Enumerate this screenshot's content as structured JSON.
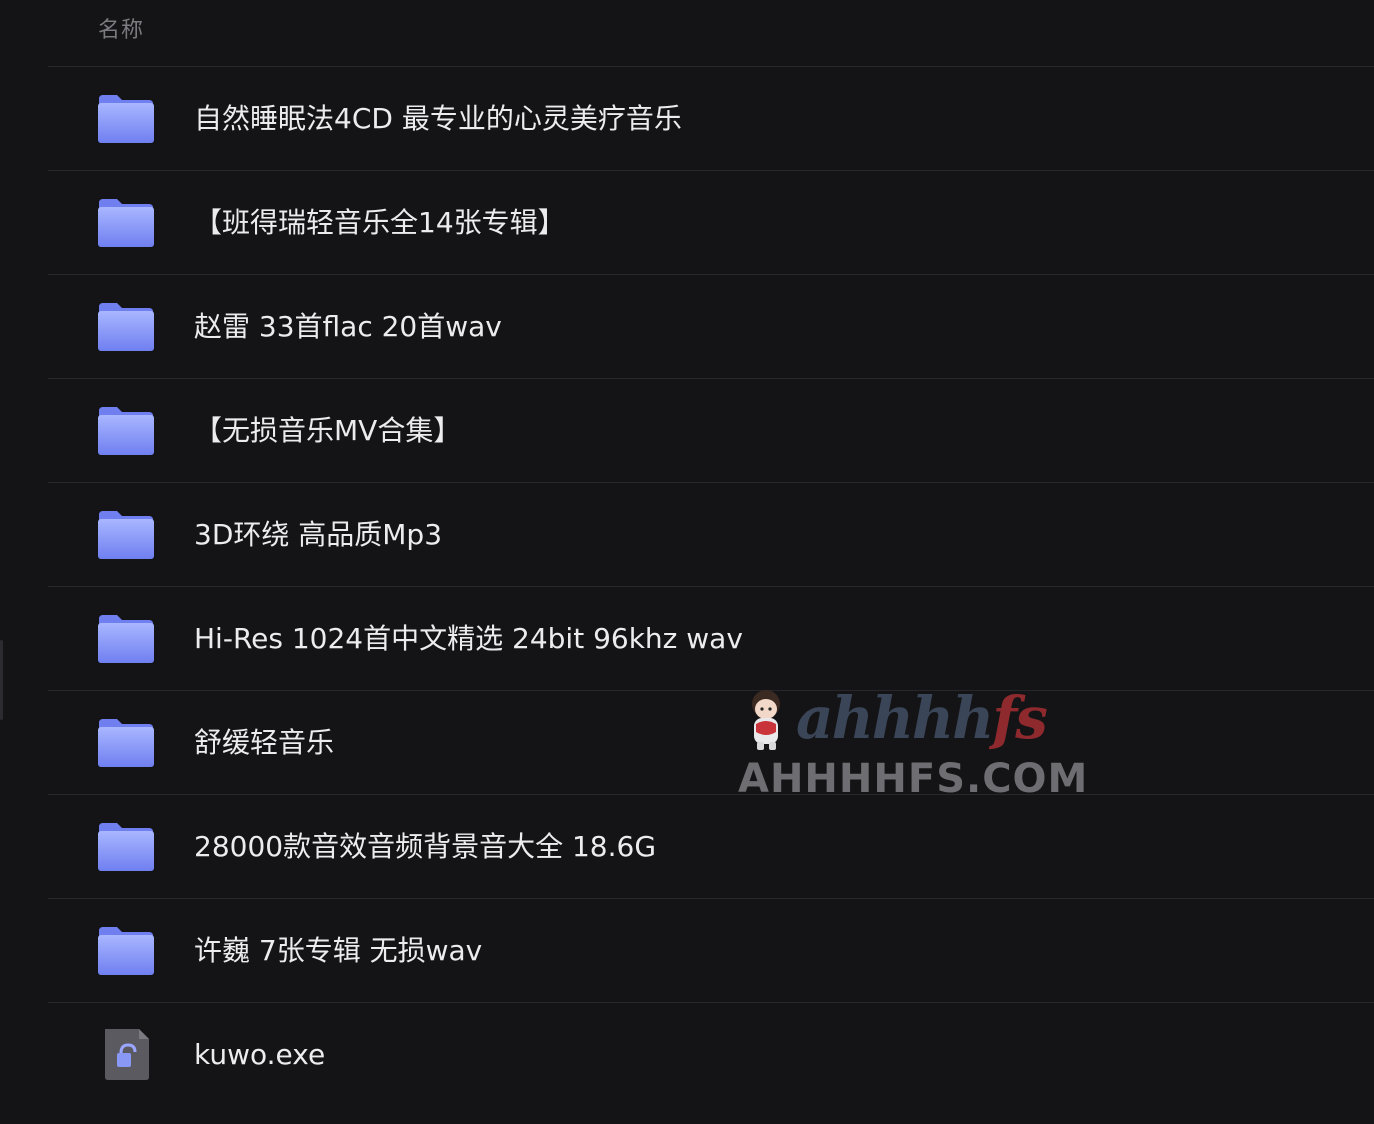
{
  "header": {
    "column_name": "名称"
  },
  "files": [
    {
      "name": "自然睡眠法4CD 最专业的心灵美疗音乐",
      "type": "folder",
      "icon": "folder-icon"
    },
    {
      "name": "【班得瑞轻音乐全14张专辑】",
      "type": "folder",
      "icon": "folder-icon"
    },
    {
      "name": "赵雷 33首flac 20首wav",
      "type": "folder",
      "icon": "folder-icon"
    },
    {
      "name": "【无损音乐MV合集】",
      "type": "folder",
      "icon": "folder-icon"
    },
    {
      "name": "3D环绕 高品质Mp3",
      "type": "folder",
      "icon": "folder-icon"
    },
    {
      "name": "Hi-Res 1024首中文精选 24bit 96khz wav",
      "type": "folder",
      "icon": "folder-icon"
    },
    {
      "name": "舒缓轻音乐",
      "type": "folder",
      "icon": "folder-icon"
    },
    {
      "name": "28000款音效音频背景音大全 18.6G",
      "type": "folder",
      "icon": "folder-icon"
    },
    {
      "name": "许巍 7张专辑 无损wav",
      "type": "folder",
      "icon": "folder-icon"
    },
    {
      "name": "kuwo.exe",
      "type": "file",
      "icon": "executable-file-icon"
    }
  ],
  "watermark": {
    "script_text": "ahhhh",
    "script_accent": "fs",
    "text": "AHHHHFS.COM"
  },
  "colors": {
    "background": "#141416",
    "divider": "#27272b",
    "folder_light": "#a9b6ff",
    "folder_dark": "#6f7ff0",
    "text": "#ececef",
    "header_text": "#7a7a80"
  }
}
